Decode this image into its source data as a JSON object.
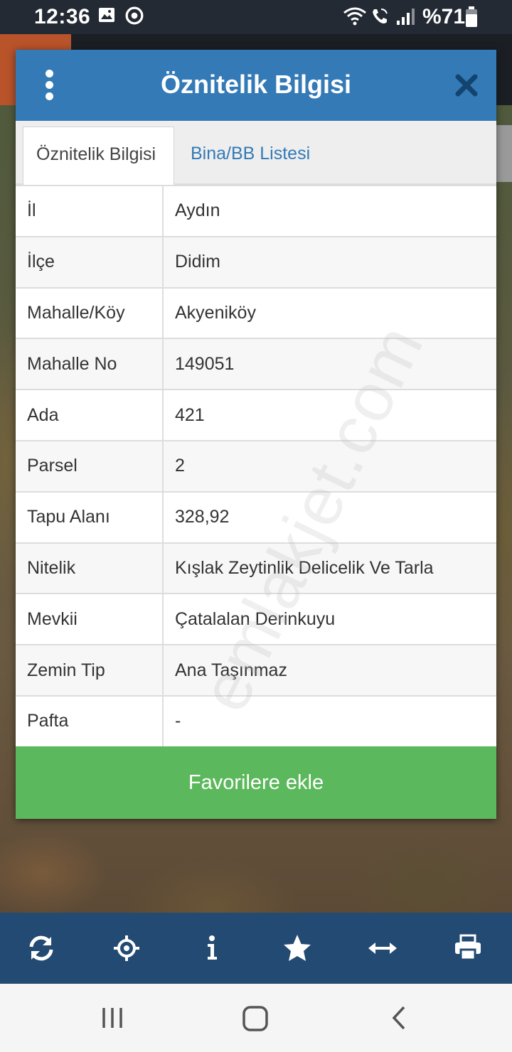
{
  "status_bar": {
    "time": "12:36",
    "battery": "%71",
    "icons": [
      "image-icon",
      "sync-icon",
      "wifi-icon",
      "wifi-call-icon",
      "signal-icon",
      "battery-icon"
    ]
  },
  "dialog": {
    "title": "Öznitelik Bilgisi",
    "menu_icon": "more-vertical-icon",
    "close_icon": "close-icon",
    "tabs": [
      {
        "label": "Öznitelik Bilgisi",
        "active": true
      },
      {
        "label": "Bina/BB Listesi",
        "active": false
      }
    ],
    "rows": [
      {
        "key": "İl",
        "value": "Aydın"
      },
      {
        "key": "İlçe",
        "value": "Didim"
      },
      {
        "key": "Mahalle/Köy",
        "value": "Akyeniköy"
      },
      {
        "key": "Mahalle No",
        "value": "149051"
      },
      {
        "key": "Ada",
        "value": "421"
      },
      {
        "key": "Parsel",
        "value": "2"
      },
      {
        "key": "Tapu Alanı",
        "value": "328,92"
      },
      {
        "key": "Nitelik",
        "value": "Kışlak Zeytinlik Delicelik Ve Tarla"
      },
      {
        "key": "Mevkii",
        "value": "Çatalalan Derinkuyu"
      },
      {
        "key": "Zemin Tip",
        "value": "Ana Taşınmaz"
      },
      {
        "key": "Pafta",
        "value": "-"
      }
    ],
    "favorite_button": "Favorilere ekle"
  },
  "watermark": "emlakjet.com",
  "toolbar": {
    "icons": [
      "refresh-icon",
      "locate-icon",
      "info-icon",
      "star-icon",
      "measure-icon",
      "print-icon"
    ]
  },
  "navbar": {
    "icons": [
      "recent-apps-icon",
      "home-icon",
      "back-icon"
    ]
  },
  "colors": {
    "header": "#337ab7",
    "favorite": "#5cb85c",
    "toolbar": "#234a73",
    "status_bar": "#232a33"
  }
}
